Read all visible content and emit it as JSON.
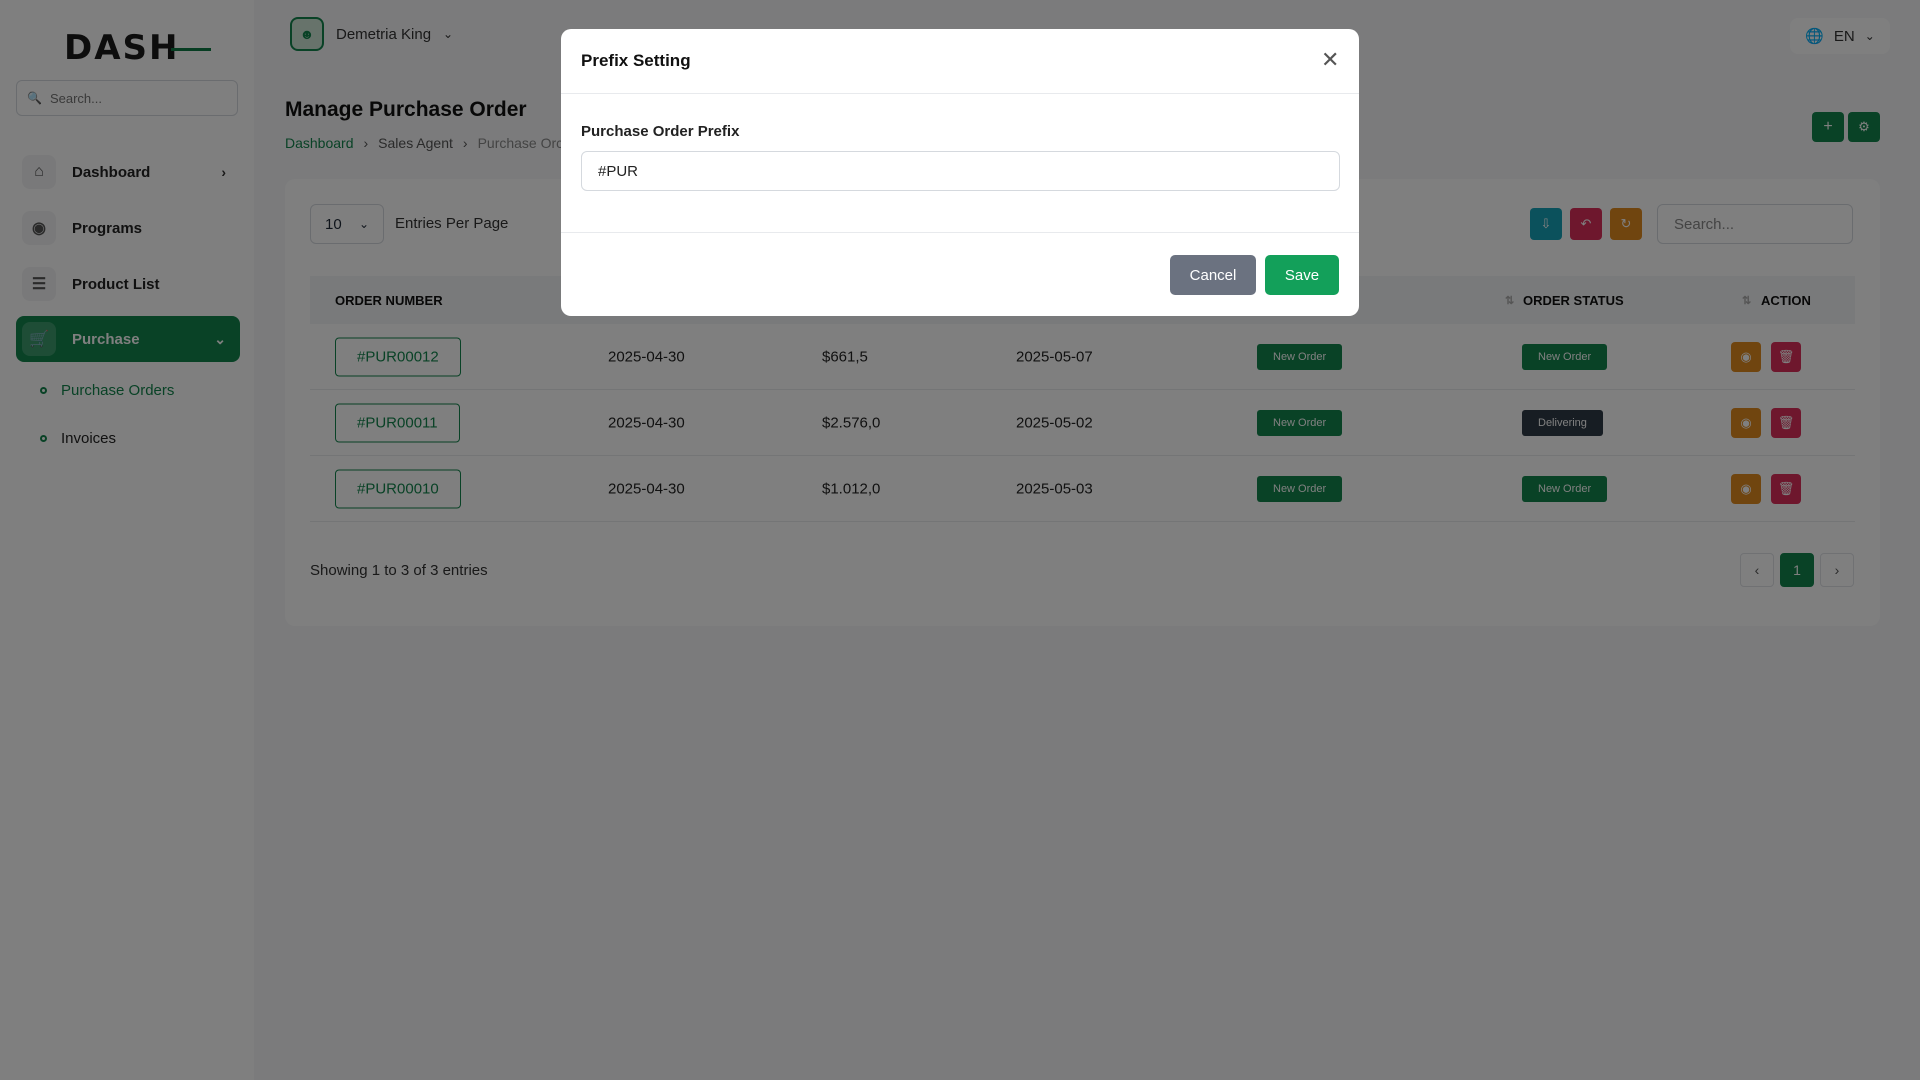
{
  "brand": {
    "logo_text": "DASH"
  },
  "sidebar": {
    "search_placeholder": "Search...",
    "items": [
      {
        "label": "Dashboard",
        "icon": "home-icon"
      },
      {
        "label": "Programs",
        "icon": "cube-icon"
      },
      {
        "label": "Product List",
        "icon": "list-icon"
      },
      {
        "label": "Purchase",
        "icon": "cart-icon"
      }
    ],
    "sub_items": [
      {
        "label": "Purchase Orders"
      },
      {
        "label": "Invoices"
      }
    ]
  },
  "topbar": {
    "user_name": "Demetria King",
    "language": "EN"
  },
  "page": {
    "title": "Manage Purchase Order",
    "breadcrumb": [
      "Dashboard",
      "Sales Agent",
      "Purchase Orc"
    ]
  },
  "table": {
    "per_page": "10",
    "per_page_label": "Entries Per Page",
    "search_placeholder": "Search...",
    "columns": {
      "order_number": "ORDER NUMBER",
      "order_status": "ORDER STATUS",
      "action": "ACTION"
    },
    "rows": [
      {
        "order": "#PUR00012",
        "date": "2025-04-30",
        "amount": "$661,5",
        "due": "2025-05-07",
        "payment_status": "New Order",
        "order_status": "New Order"
      },
      {
        "order": "#PUR00011",
        "date": "2025-04-30",
        "amount": "$2.576,0",
        "due": "2025-05-02",
        "payment_status": "New Order",
        "order_status": "Delivering"
      },
      {
        "order": "#PUR00010",
        "date": "2025-04-30",
        "amount": "$1.012,0",
        "due": "2025-05-03",
        "payment_status": "New Order",
        "order_status": "New Order"
      }
    ],
    "showing": "Showing 1 to 3 of 3 entries",
    "page": "1"
  },
  "modal": {
    "title": "Prefix Setting",
    "field_label": "Purchase Order Prefix",
    "field_value": "#PUR",
    "cancel": "Cancel",
    "save": "Save"
  },
  "colors": {
    "primary": "#13854d",
    "info": "#17a2b8",
    "danger": "#dc2f5a",
    "warning": "#e08a1e"
  }
}
